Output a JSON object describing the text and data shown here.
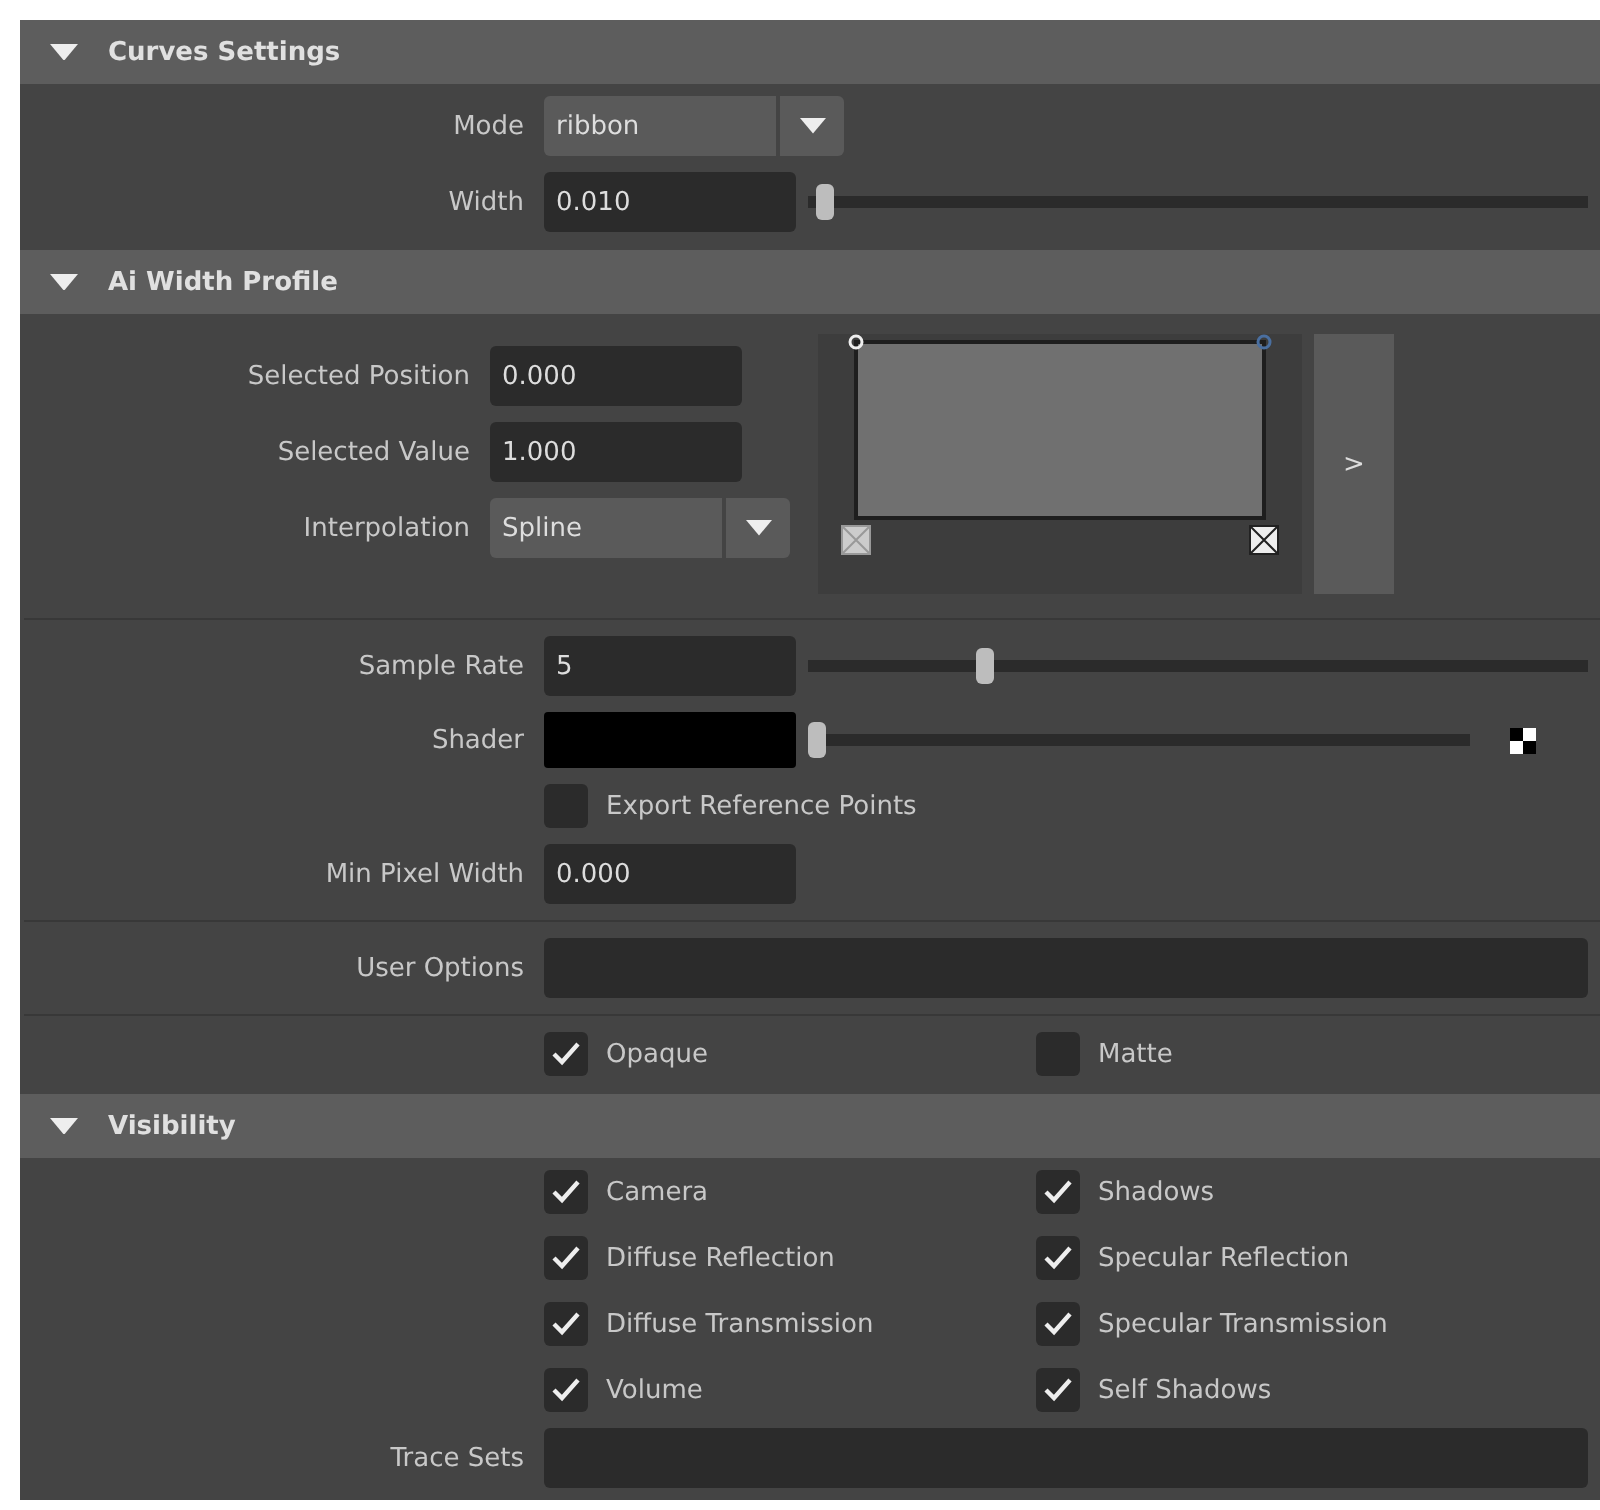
{
  "sections": [
    {
      "title": "Curves Settings",
      "expanded": true,
      "rows": [
        {
          "kind": "dropdown",
          "label": "Mode",
          "value": "ribbon"
        },
        {
          "kind": "slider",
          "label": "Width",
          "value": "0.010",
          "level": 0.01
        }
      ]
    },
    {
      "title": "Ai Width Profile",
      "expanded": true,
      "rows": [
        {
          "kind": "profile",
          "fields": [
            {
              "label": "Selected Position",
              "value": "0.000"
            },
            {
              "label": "Selected Value",
              "value": "1.000"
            }
          ],
          "interpolation": {
            "label": "Interpolation",
            "value": "Spline"
          },
          "button": ">"
        },
        {
          "kind": "separator"
        },
        {
          "kind": "slider",
          "label": "Sample Rate",
          "value": "5",
          "level": 0.22
        },
        {
          "kind": "color_slider",
          "label": "Shader",
          "color": "#000000",
          "level": 0.0
        },
        {
          "kind": "checkbox",
          "label": "Export Reference Points",
          "checked": false
        },
        {
          "kind": "field",
          "label": "Min Pixel Width",
          "value": "0.000"
        },
        {
          "kind": "separator"
        },
        {
          "kind": "text",
          "label": "User Options",
          "value": ""
        },
        {
          "kind": "separator"
        },
        {
          "kind": "checkbox_grid",
          "items": [
            {
              "label": "Opaque",
              "checked": true
            },
            {
              "label": "Matte",
              "checked": false
            }
          ]
        }
      ]
    },
    {
      "title": "Visibility",
      "expanded": true,
      "rows": [
        {
          "kind": "checkbox_grid",
          "items": [
            {
              "label": "Camera",
              "checked": true
            },
            {
              "label": "Shadows",
              "checked": true
            },
            {
              "label": "Diffuse Reflection",
              "checked": true
            },
            {
              "label": "Specular Reflection",
              "checked": true
            },
            {
              "label": "Diffuse Transmission",
              "checked": true
            },
            {
              "label": "Specular Transmission",
              "checked": true
            },
            {
              "label": "Volume",
              "checked": true
            },
            {
              "label": "Self Shadows",
              "checked": true
            }
          ]
        },
        {
          "kind": "text",
          "label": "Trace Sets",
          "value": ""
        }
      ]
    }
  ]
}
